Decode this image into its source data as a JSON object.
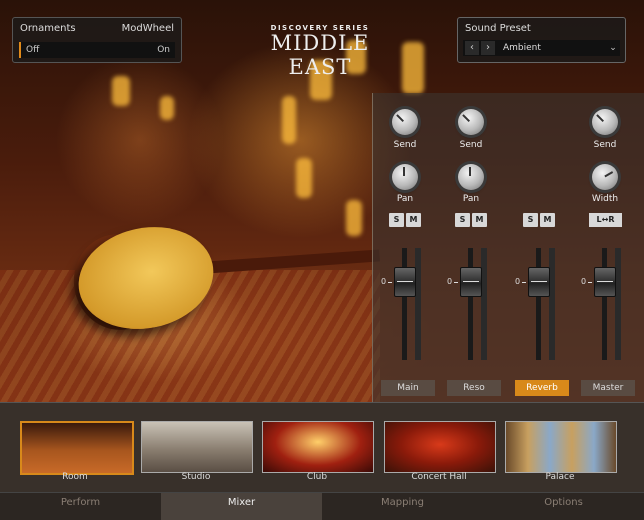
{
  "header": {
    "ornaments": {
      "label": "Ornaments",
      "controller": "ModWheel",
      "state": "Off",
      "controller_state": "On"
    },
    "logo": {
      "series": "DISCOVERY SERIES",
      "title": "MIDDLE EAST"
    },
    "sound_preset": {
      "label": "Sound Preset",
      "value": "Ambient",
      "prev_icon": "chevron-left-icon",
      "next_icon": "chevron-right-icon"
    }
  },
  "mixer": {
    "strips": [
      {
        "name": "Main",
        "send_label": "Send",
        "pan_label": "Pan",
        "solo": "S",
        "mute": "M",
        "fader_label": "0",
        "active": false
      },
      {
        "name": "Reso",
        "send_label": "Send",
        "pan_label": "Pan",
        "solo": "S",
        "mute": "M",
        "fader_label": "0",
        "active": false
      },
      {
        "name": "Reverb",
        "solo": "S",
        "mute": "M",
        "fader_label": "0",
        "active": true
      },
      {
        "name": "Master",
        "send_label": "Send",
        "width_label": "Width",
        "lr_label": "L↔R",
        "fader_label": "0",
        "active": false
      }
    ]
  },
  "rooms": {
    "items": [
      {
        "label": "Room",
        "selected": true
      },
      {
        "label": "Studio",
        "selected": false
      },
      {
        "label": "Club",
        "selected": false
      },
      {
        "label": "Concert Hall",
        "selected": false
      },
      {
        "label": "Palace",
        "selected": false
      }
    ]
  },
  "tabs": [
    {
      "label": "Perform",
      "active": false
    },
    {
      "label": "Mixer",
      "active": true
    },
    {
      "label": "Mapping",
      "active": false
    },
    {
      "label": "Options",
      "active": false
    }
  ],
  "colors": {
    "accent": "#d8891a"
  }
}
